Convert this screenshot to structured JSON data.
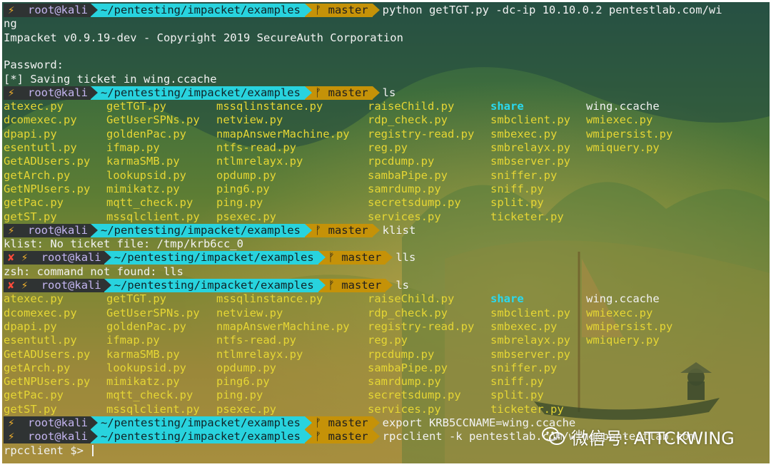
{
  "prompt": {
    "user_host": "root@kali",
    "path": "~/pentesting/impacket/examples",
    "branch": "master",
    "bolt_glyph": "⚡",
    "git_glyph": "ᚠ",
    "error_glyph": "✘"
  },
  "lines": [
    {
      "type": "prompt",
      "cmd": "python getTGT.py -dc-ip 10.10.0.2 pentestlab.com/wi"
    },
    {
      "type": "text",
      "text": "ng"
    },
    {
      "type": "text",
      "text": "Impacket v0.9.19-dev - Copyright 2019 SecureAuth Corporation"
    },
    {
      "type": "text",
      "text": ""
    },
    {
      "type": "text",
      "text": "Password:"
    },
    {
      "type": "text",
      "text": "[*] Saving ticket in wing.ccache"
    },
    {
      "type": "prompt",
      "cmd": "ls"
    },
    {
      "type": "ls",
      "block": 0
    },
    {
      "type": "prompt",
      "cmd": "klist"
    },
    {
      "type": "text",
      "text": "klist: No ticket file: /tmp/krb6cc_0"
    },
    {
      "type": "prompt",
      "error": true,
      "cmd": "lls"
    },
    {
      "type": "text",
      "text": "zsh: command not found: lls"
    },
    {
      "type": "prompt",
      "error": true,
      "cmd": "ls"
    },
    {
      "type": "ls",
      "block": 1
    },
    {
      "type": "prompt",
      "cmd": "export KRB5CCNAME=wing.ccache"
    },
    {
      "type": "prompt",
      "cmd": "rpcclient -k pentestlab.com/wing@pentestlab.com"
    },
    {
      "type": "text",
      "text": "rpcclient $> ",
      "cursor": true
    }
  ],
  "ls_columns": [
    [
      "atexec.py",
      "dcomexec.py",
      "dpapi.py",
      "esentutl.py",
      "GetADUsers.py",
      "getArch.py",
      "GetNPUsers.py",
      "getPac.py",
      "getST.py"
    ],
    [
      "getTGT.py",
      "GetUserSPNs.py",
      "goldenPac.py",
      "ifmap.py",
      "karmaSMB.py",
      "lookupsid.py",
      "mimikatz.py",
      "mqtt_check.py",
      "mssqlclient.py"
    ],
    [
      "mssqlinstance.py",
      "netview.py",
      "nmapAnswerMachine.py",
      "ntfs-read.py",
      "ntlmrelayx.py",
      "opdump.py",
      "ping6.py",
      "ping.py",
      "psexec.py"
    ],
    [
      "raiseChild.py",
      "rdp_check.py",
      "registry-read.py",
      "reg.py",
      "rpcdump.py",
      "sambaPipe.py",
      "samrdump.py",
      "secretsdump.py",
      "services.py"
    ],
    [
      "share",
      "smbclient.py",
      "smbexec.py",
      "smbrelayx.py",
      "smbserver.py",
      "sniffer.py",
      "sniff.py",
      "split.py",
      "ticketer.py"
    ],
    [
      "wing.ccache",
      "wmiexec.py",
      "wmipersist.py",
      "wmiquery.py"
    ]
  ],
  "directory_entries": [
    "share"
  ],
  "plain_entries": [
    "wing.ccache"
  ],
  "watermark": {
    "text": "微信号: ATTCKWING",
    "icon": "wechat-icon"
  },
  "colors": {
    "segment_user": "#2f3333",
    "segment_path": "#28d3de",
    "segment_git": "#c59208",
    "file": "#e6d634",
    "directory": "#2ad9f0",
    "error": "#ff4b3a",
    "bolt": "#f1b12c"
  }
}
